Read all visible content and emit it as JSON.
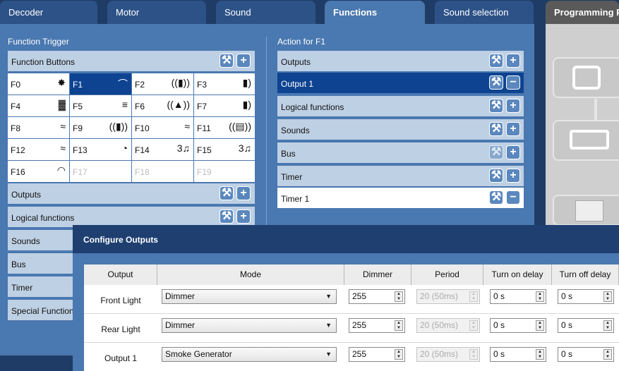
{
  "tabs": [
    "Decoder",
    "Motor",
    "Sound",
    "Functions",
    "Sound selection",
    "Programming Pa"
  ],
  "left": {
    "title": "Function Trigger",
    "function_buttons_label": "Function Buttons",
    "functions": [
      {
        "label": "F0",
        "icon": "✸"
      },
      {
        "label": "F1",
        "icon": "⌒"
      },
      {
        "label": "F2",
        "icon": "((▮))"
      },
      {
        "label": "F3",
        "icon": "▮)"
      },
      {
        "label": "F4",
        "icon": "▓"
      },
      {
        "label": "F5",
        "icon": "≡"
      },
      {
        "label": "F6",
        "icon": "((▲))"
      },
      {
        "label": "F7",
        "icon": "▮)"
      },
      {
        "label": "F8",
        "icon": "≈"
      },
      {
        "label": "F9",
        "icon": "((▮))"
      },
      {
        "label": "F10",
        "icon": "≈"
      },
      {
        "label": "F11",
        "icon": "((▤))"
      },
      {
        "label": "F12",
        "icon": "≈"
      },
      {
        "label": "F13",
        "icon": "◔"
      },
      {
        "label": "F14",
        "icon": "3♫"
      },
      {
        "label": "F15",
        "icon": "3♫"
      },
      {
        "label": "F16",
        "icon": "◠"
      },
      {
        "label": "F17",
        "icon": ""
      },
      {
        "label": "F18",
        "icon": ""
      },
      {
        "label": "F19",
        "icon": ""
      }
    ],
    "bars": [
      "Outputs",
      "Logical functions",
      "Sounds",
      "Bus",
      "Timer",
      "Special Functions"
    ]
  },
  "right": {
    "title": "Action for F1",
    "bars": [
      "Outputs",
      "Output 1",
      "Logical functions",
      "Sounds",
      "Bus",
      "Timer",
      "Timer 1"
    ]
  },
  "dialog": {
    "title": "Configure Outputs",
    "headers": [
      "Output",
      "Mode",
      "Dimmer",
      "Period",
      "Turn on delay",
      "Turn off delay"
    ],
    "rows": [
      {
        "name": "Front Light",
        "mode": "Dimmer",
        "dimmer": "255",
        "period": "20 (50ms)",
        "on": "0 s",
        "off": "0 s"
      },
      {
        "name": "Rear Light",
        "mode": "Dimmer",
        "dimmer": "255",
        "period": "20 (50ms)",
        "on": "0 s",
        "off": "0 s"
      },
      {
        "name": "Output 1",
        "mode": "Smoke Generator",
        "dimmer": "255",
        "period": "20 (50ms)",
        "on": "0 s",
        "off": "0 s"
      }
    ]
  },
  "icons": {
    "edit": "wrench-icon",
    "add": "plus-icon",
    "remove": "minus-icon"
  },
  "colors": {
    "accent": "#0e4391",
    "panel": "#4a78b0",
    "bar": "#bed0e4"
  }
}
